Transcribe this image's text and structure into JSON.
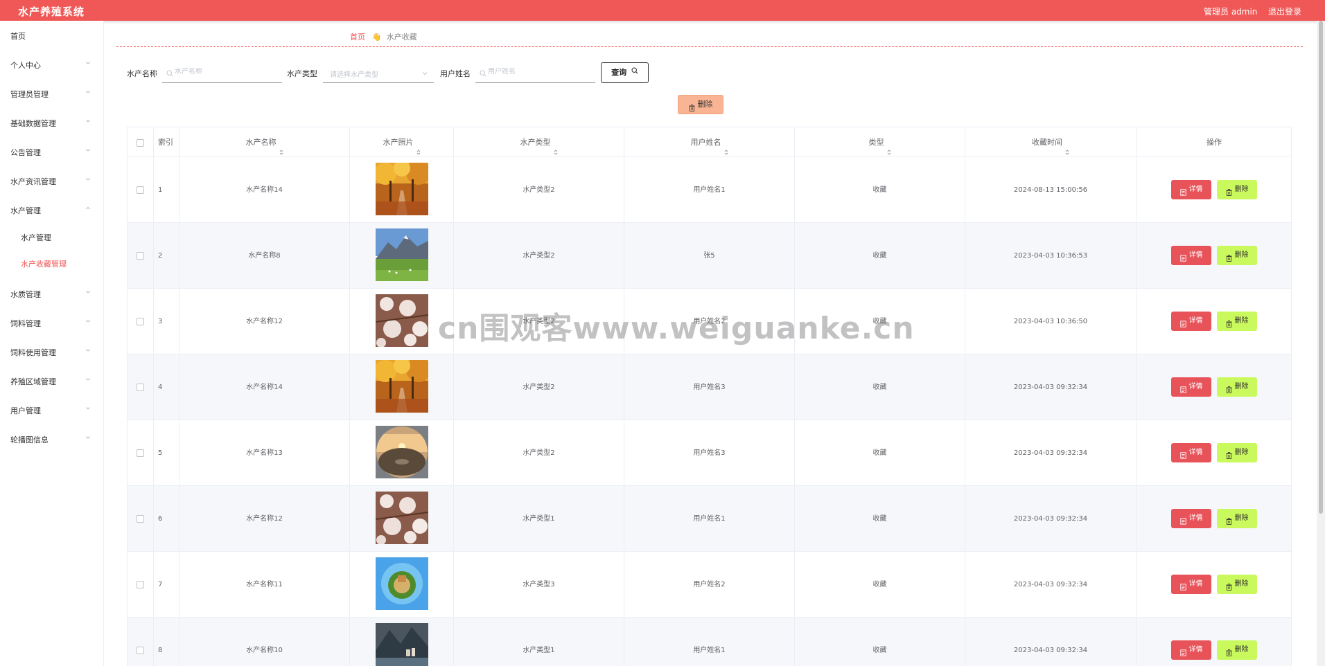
{
  "header": {
    "title": "水产养殖系统",
    "user_label": "管理员 admin",
    "logout_label": "退出登录"
  },
  "sidebar": {
    "items": [
      {
        "label": "首页",
        "has_children": false
      },
      {
        "label": "个人中心",
        "has_children": true
      },
      {
        "label": "管理员管理",
        "has_children": true
      },
      {
        "label": "基础数据管理",
        "has_children": true
      },
      {
        "label": "公告管理",
        "has_children": true
      },
      {
        "label": "水产资讯管理",
        "has_children": true
      },
      {
        "label": "水产管理",
        "has_children": true,
        "expanded": true
      },
      {
        "label": "水质管理",
        "has_children": true
      },
      {
        "label": "饲料管理",
        "has_children": true
      },
      {
        "label": "饲料使用管理",
        "has_children": true
      },
      {
        "label": "养殖区域管理",
        "has_children": true
      },
      {
        "label": "用户管理",
        "has_children": true
      },
      {
        "label": "轮播图信息",
        "has_children": true
      }
    ],
    "subitems": [
      {
        "label": "水产管理",
        "active": false
      },
      {
        "label": "水产收藏管理",
        "active": true
      }
    ]
  },
  "breadcrumb": {
    "home": "首页",
    "current": "水产收藏"
  },
  "search": {
    "name_label": "水产名称",
    "name_placeholder": "水产名称",
    "type_label": "水产类型",
    "type_placeholder": "请选择水产类型",
    "user_label": "用户姓名",
    "user_placeholder": "用户姓名",
    "query_label": "查询"
  },
  "actions": {
    "batch_delete_label": "删除"
  },
  "table": {
    "headers": [
      "索引",
      "水产名称",
      "水产照片",
      "水产类型",
      "用户姓名",
      "类型",
      "收藏时间",
      "操作"
    ],
    "detail_label": "详情",
    "delete_label": "删除",
    "rows": [
      {
        "index": "1",
        "name": "水产名称14",
        "photo": "autumn-trees",
        "type": "水产类型2",
        "user": "用户姓名1",
        "kind": "收藏",
        "time": "2024-08-13 15:00:56"
      },
      {
        "index": "2",
        "name": "水产名称8",
        "photo": "mountain-meadow",
        "type": "水产类型2",
        "user": "张5",
        "kind": "收藏",
        "time": "2023-04-03 10:36:53"
      },
      {
        "index": "3",
        "name": "水产名称12",
        "photo": "white-blossoms",
        "type": "水产类型2",
        "user": "用户姓名2",
        "kind": "收藏",
        "time": "2023-04-03 10:36:50"
      },
      {
        "index": "4",
        "name": "水产名称14",
        "photo": "autumn-trees",
        "type": "水产类型2",
        "user": "用户姓名3",
        "kind": "收藏",
        "time": "2023-04-03 09:32:34"
      },
      {
        "index": "5",
        "name": "水产名称13",
        "photo": "sunset-sphere",
        "type": "水产类型2",
        "user": "用户姓名3",
        "kind": "收藏",
        "time": "2023-04-03 09:32:34"
      },
      {
        "index": "6",
        "name": "水产名称12",
        "photo": "white-blossoms",
        "type": "水产类型1",
        "user": "用户姓名1",
        "kind": "收藏",
        "time": "2023-04-03 09:32:34"
      },
      {
        "index": "7",
        "name": "水产名称11",
        "photo": "tiny-planet",
        "type": "水产类型3",
        "user": "用户姓名2",
        "kind": "收藏",
        "time": "2023-04-03 09:32:34"
      },
      {
        "index": "8",
        "name": "水产名称10",
        "photo": "lake-village",
        "type": "水产类型1",
        "user": "用户姓名1",
        "kind": "收藏",
        "time": "2023-04-03 09:32:34"
      }
    ]
  },
  "watermark": "cn围观客www.weiguanke.cn",
  "colors": {
    "primary": "#ef5856",
    "detail_button": "#e8535a",
    "delete_button": "#c9f95c",
    "batch_delete": "#f9b593"
  }
}
